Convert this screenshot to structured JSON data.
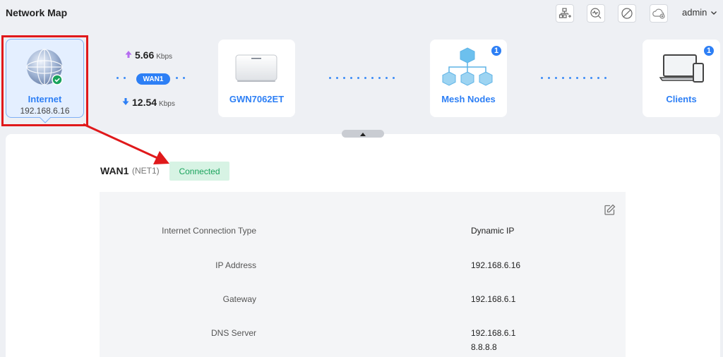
{
  "header": {
    "title": "Network Map",
    "user": "admin",
    "toolbar_icons": [
      "topology-add-icon",
      "diagnostics-icon",
      "block-icon",
      "cloud-off-icon"
    ]
  },
  "map": {
    "internet": {
      "label": "Internet",
      "ip": "192.168.6.16",
      "status": "connected"
    },
    "wan": {
      "pill": "WAN1",
      "upload_value": "5.66",
      "upload_unit": "Kbps",
      "download_value": "12.54",
      "download_unit": "Kbps"
    },
    "router": {
      "label": "GWN7062ET"
    },
    "mesh": {
      "label": "Mesh Nodes",
      "count": "1"
    },
    "clients": {
      "label": "Clients",
      "count": "1"
    }
  },
  "details": {
    "wan_name": "WAN1",
    "wan_net": "(NET1)",
    "status": "Connected",
    "rows": [
      {
        "label": "Internet Connection Type",
        "value": "Dynamic IP"
      },
      {
        "label": "IP Address",
        "value": "192.168.6.16"
      },
      {
        "label": "Gateway",
        "value": "192.168.6.1"
      },
      {
        "label": "DNS Server",
        "value": "192.168.6.1",
        "value2": "8.8.8.8"
      }
    ]
  },
  "colors": {
    "accent": "#2d7ff5",
    "status_green": "#1aa35c",
    "status_bg": "#d7f3e4",
    "annotation_red": "#e0191b"
  }
}
